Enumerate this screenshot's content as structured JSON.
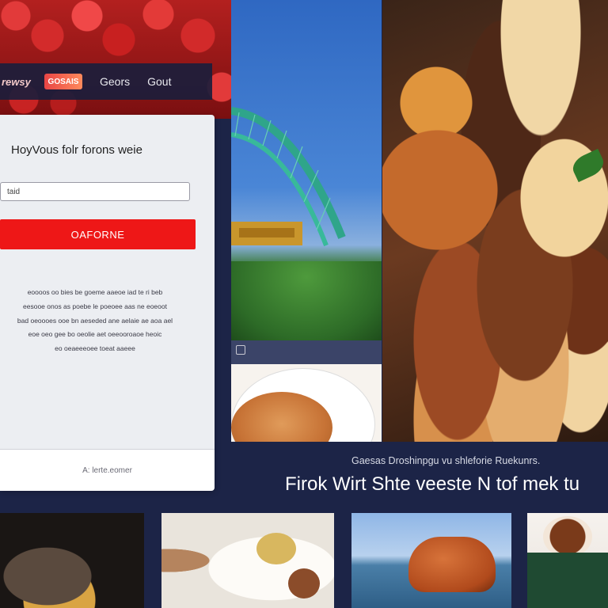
{
  "nav": {
    "logo_text": "rewsy",
    "badge_text": "GOSAIS",
    "items": [
      {
        "label": "Geors"
      },
      {
        "label": "Gout"
      }
    ]
  },
  "login_card": {
    "title": "HoyVous folr forons weie",
    "email_input": {
      "value": "taid",
      "placeholder": ""
    },
    "submit_label": "OAFORNE",
    "body_lines": [
      "eoooos oo bies be goeme aaeoe iad te ri beb",
      "eesooe onos as poebe le poeoee aas ne eoeoot",
      "bad oeoooes ooe bn aeseded ane aelaie ae aoa ael",
      "eoe oeo gee bo oeolie aet oeeooroaoe heoic",
      "eo oeaeeeoee toeat aaeee"
    ],
    "footer_link": "A: lerte.eomer"
  },
  "banner": {
    "kicker": "Gaesas Droshinpgu vu shleforie Ruekunrs.",
    "title": "Firok Wirt Shte veeste N tof mek tu"
  },
  "colors": {
    "accent": "#ee1717",
    "navy": "#1c2447",
    "card_bg": "#eceef2"
  }
}
